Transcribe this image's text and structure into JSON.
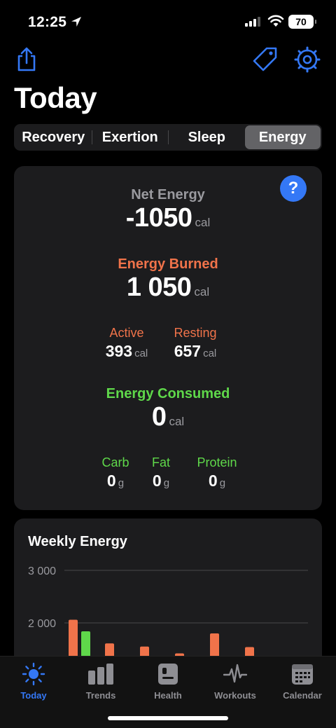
{
  "status": {
    "time": "12:25",
    "battery": "70"
  },
  "header": {
    "title": "Today"
  },
  "segments": [
    {
      "label": "Recovery",
      "active": false
    },
    {
      "label": "Exertion",
      "active": false
    },
    {
      "label": "Sleep",
      "active": false
    },
    {
      "label": "Energy",
      "active": true
    }
  ],
  "energy": {
    "help": "?",
    "net": {
      "label": "Net Energy",
      "value": "-1050",
      "unit": "cal"
    },
    "burned": {
      "label": "Energy Burned",
      "value": "1 050",
      "unit": "cal"
    },
    "active": {
      "label": "Active",
      "value": "393",
      "unit": "cal"
    },
    "resting": {
      "label": "Resting",
      "value": "657",
      "unit": "cal"
    },
    "consumed": {
      "label": "Energy Consumed",
      "value": "0",
      "unit": "cal"
    },
    "carb": {
      "label": "Carb",
      "value": "0",
      "unit": "g"
    },
    "fat": {
      "label": "Fat",
      "value": "0",
      "unit": "g"
    },
    "protein": {
      "label": "Protein",
      "value": "0",
      "unit": "g"
    }
  },
  "weekly": {
    "title": "Weekly Energy",
    "chart_data": {
      "type": "bar",
      "title": "Weekly Energy",
      "ylim": [
        0,
        3000
      ],
      "yticks": [
        {
          "value": 3000,
          "label": "3 000"
        },
        {
          "value": 2000,
          "label": "2 000"
        }
      ],
      "grid": true,
      "series": [
        {
          "color": "#f0734a",
          "values": [
            2060,
            1610,
            1550,
            1420,
            1800,
            1540
          ]
        },
        {
          "color": "#5fd84a",
          "values": [
            1840
          ]
        }
      ]
    }
  },
  "tabbar": [
    {
      "label": "Today",
      "icon": "sun-icon",
      "active": true
    },
    {
      "label": "Trends",
      "icon": "bar-chart-icon",
      "active": false
    },
    {
      "label": "Health",
      "icon": "health-record-icon",
      "active": false
    },
    {
      "label": "Workouts",
      "icon": "heartbeat-icon",
      "active": false
    },
    {
      "label": "Calendar",
      "icon": "calendar-icon",
      "active": false
    }
  ],
  "colors": {
    "accent": "#3478f6",
    "burned": "#f0734a",
    "consumed": "#5fd84a"
  }
}
